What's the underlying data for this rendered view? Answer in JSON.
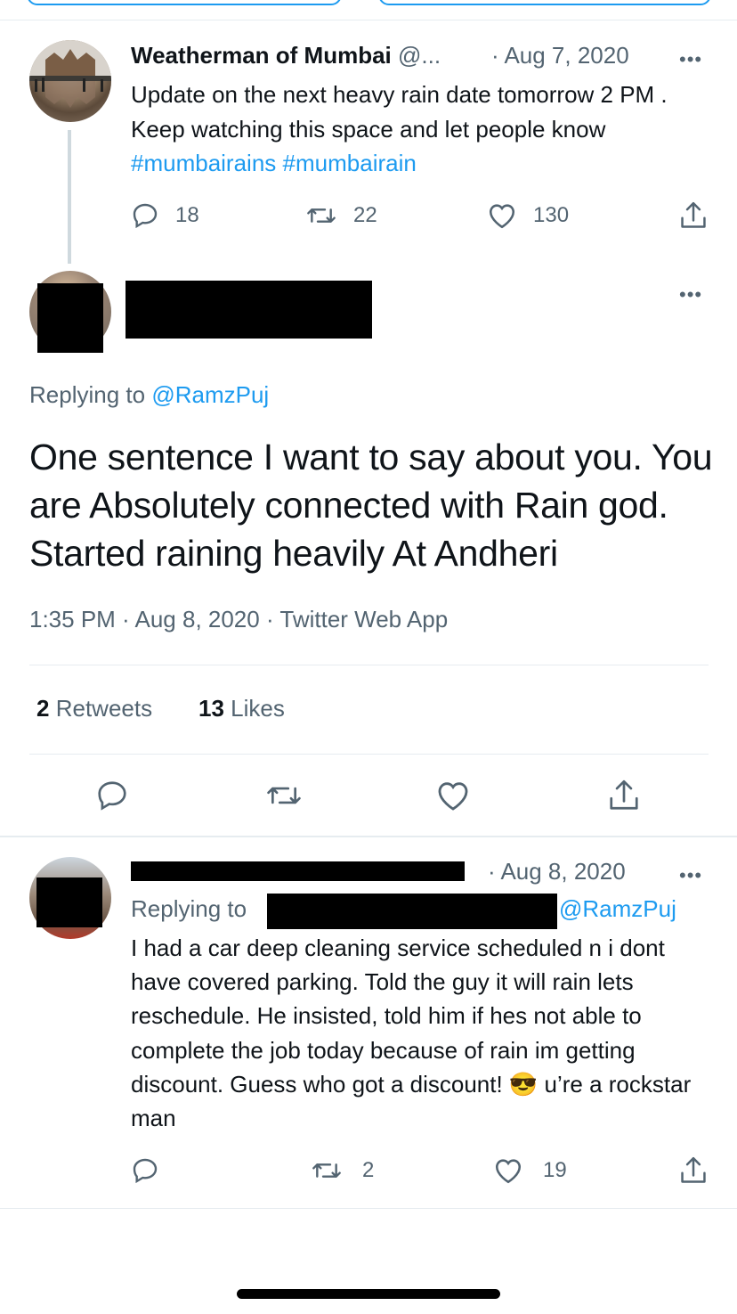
{
  "tweet1": {
    "author_name": "Weatherman of Mumbai",
    "author_handle": "@...",
    "date": "· Aug 7, 2020",
    "text_part": "Update on the next heavy rain date tomorrow 2 PM .  Keep watching this space and let people know ",
    "hashtag1": "#mumbairains",
    "hashtag2": "#mumbairain",
    "stats": {
      "replies": "18",
      "retweets": "22",
      "likes": "130"
    }
  },
  "main": {
    "replying_prefix": "Replying to ",
    "replying_handle": "@RamzPuj",
    "text": "One sentence I want to say about you. You are Absolutely connected with Rain god. Started raining heavily At Andheri",
    "meta": "1:35 PM · Aug 8, 2020 · Twitter Web App",
    "retweets_count": "2",
    "retweets_label": "Retweets",
    "likes_count": "13",
    "likes_label": "Likes"
  },
  "reply": {
    "date": "· Aug 8, 2020",
    "replying_prefix": "Replying to",
    "replying_handle": "@RamzPuj",
    "text": "I had a car deep cleaning service scheduled n i dont have covered parking. Told the guy it will rain lets reschedule. He insisted, told him if hes not able to complete the job today because of rain im getting discount. Guess who got a discount! 😎 u’re a rockstar man",
    "stats": {
      "replies": "",
      "retweets": "2",
      "likes": "19"
    }
  },
  "icons": [
    "reply-icon",
    "retweet-icon",
    "like-icon",
    "share-icon",
    "more-icon"
  ],
  "colors": {
    "link": "#1d9bf0",
    "muted": "#536471",
    "text": "#0f1419",
    "divider": "#e6ecf0"
  }
}
